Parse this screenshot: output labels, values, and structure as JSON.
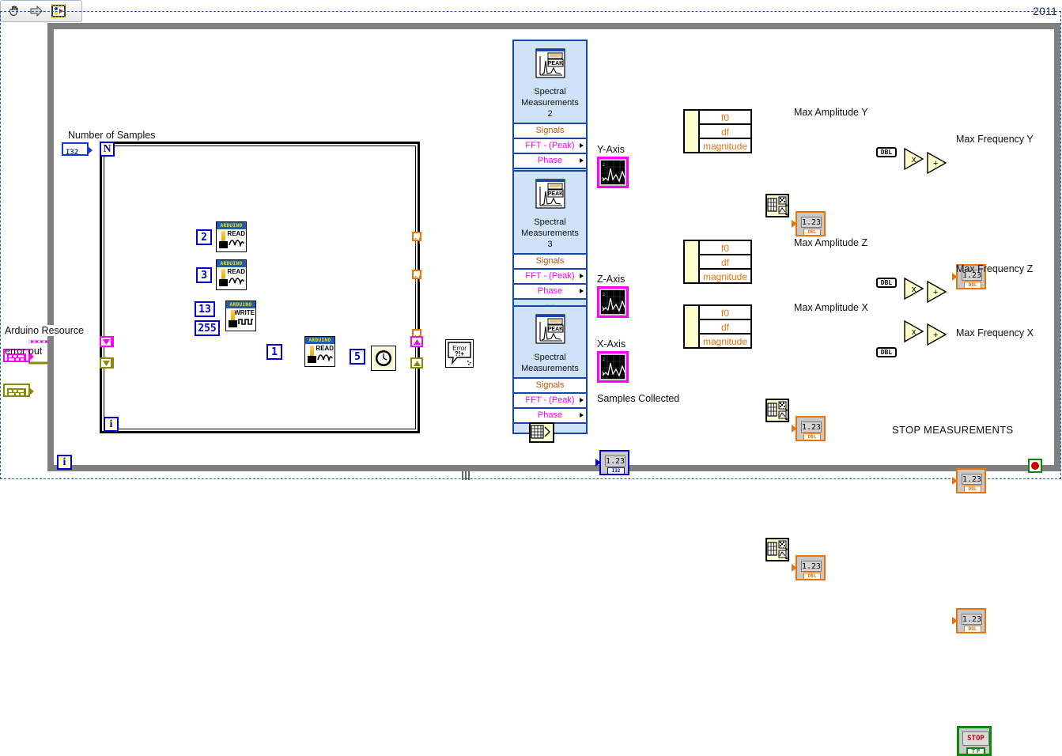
{
  "toolbar": {
    "icons": [
      "hand-tool-icon",
      "arrow-tool-icon",
      "vi-icon"
    ]
  },
  "year_badge": "2011",
  "labels": {
    "number_of_samples": "Number of Samples",
    "arduino_resource": "Arduino Resource",
    "error_out": "error out",
    "y_axis": "Y-Axis",
    "z_axis": "Z-Axis",
    "x_axis": "X-Axis",
    "samples_collected": "Samples Collected",
    "max_amplitude_y": "Max Amplitude Y",
    "max_amplitude_z": "Max Amplitude Z",
    "max_amplitude_x": "Max Amplitude X",
    "max_frequency_y": "Max Frequency Y",
    "max_frequency_z": "Max Frequency Z",
    "max_frequency_x": "Max Frequency X",
    "stop_measurements": "STOP MEASUREMENTS"
  },
  "constants": {
    "pin_2": "2",
    "pin_3": "3",
    "pin_13": "13",
    "pwm_255": "255",
    "pin_1": "1",
    "wait_ms": "5"
  },
  "loop_terminals": {
    "count": "N",
    "iteration_for": "i",
    "iteration_while": "i"
  },
  "arduino_nodes": [
    {
      "header": "ARDUINO",
      "action": "READ",
      "kind": "analog"
    },
    {
      "header": "ARDUINO",
      "action": "READ",
      "kind": "analog"
    },
    {
      "header": "ARDUINO",
      "action": "WRITE",
      "kind": "pwm"
    },
    {
      "header": "ARDUINO",
      "action": "READ",
      "kind": "analog"
    }
  ],
  "spectral": [
    {
      "icon": "peak-spectrum-icon",
      "title": "Spectral\nMeasurements\n2",
      "title_lines": [
        "Spectral",
        "Measurements",
        "2"
      ],
      "rows": [
        "Signals",
        "FFT - (Peak)",
        "Phase"
      ]
    },
    {
      "icon": "peak-spectrum-icon",
      "title_lines": [
        "Spectral",
        "Measurements",
        "3"
      ],
      "rows": [
        "Signals",
        "FFT - (Peak)",
        "Phase"
      ]
    },
    {
      "icon": "peak-spectrum-icon",
      "title_lines": [
        "Spectral",
        "Measurements",
        ""
      ],
      "rows": [
        "Signals",
        "FFT - (Peak)",
        "Phase"
      ]
    }
  ],
  "cluster_items": [
    "f0",
    "df",
    "magnitude"
  ],
  "indicator_value": "1.23",
  "representation": {
    "dbl": "DBL",
    "i32": "I32"
  },
  "coercion": {
    "dbl": "DBL"
  },
  "operators": {
    "multiply": "x",
    "add": "+"
  },
  "stop_button": {
    "caption": "STOP",
    "rep": "T F"
  },
  "error_node": {
    "line1": "Error",
    "line2": "?!+"
  },
  "colors": {
    "wire_dynamic": "#ff00ff",
    "wire_orange": "#e8740c",
    "wire_blue": "#1a38c8",
    "wire_error": "#8a8a00",
    "node_blue": "#1347b0",
    "loop_gray": "#808080",
    "boundary_blue": "#2b5fa8",
    "stop_green": "#0a8a0a"
  }
}
